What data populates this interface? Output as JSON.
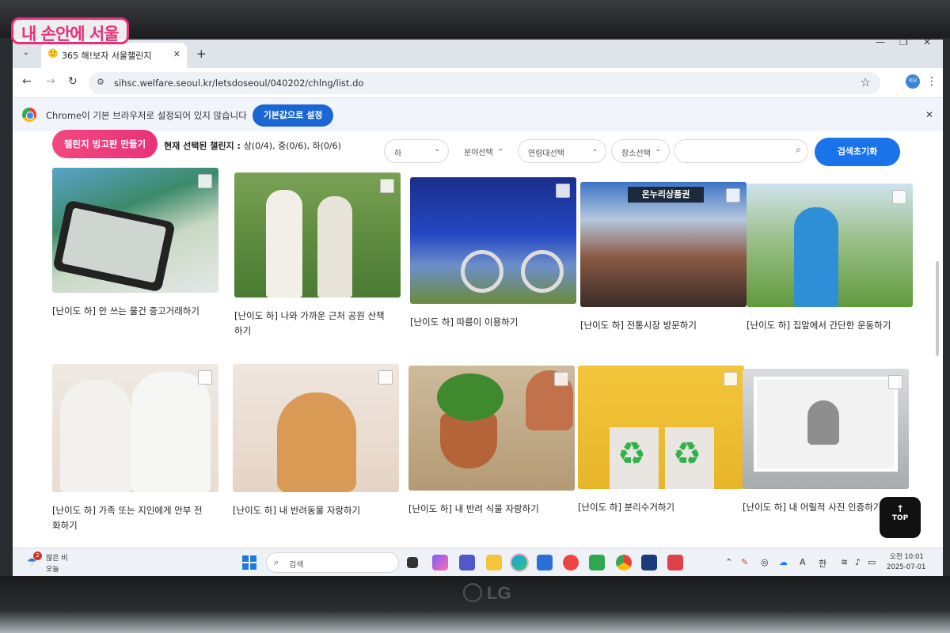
{
  "watermark": {
    "logo_text": "내 손안에 서울"
  },
  "monitor": {
    "brand": "LG"
  },
  "browser": {
    "tab_title": "365 해!보자 서울챌린지",
    "url": "sihsc.welfare.seoul.kr/letsdoseoul/040202/chlng/list.do",
    "infobar_text": "Chrome이 기본 브라우저로 설정되어 있지 않습니다",
    "infobar_button": "기본값으로 설정",
    "profile_label": "외부"
  },
  "filters": {
    "bingo_button": "챌린지 빙고판 만들기",
    "status_prefix": "현재 선택된 챌린지 : ",
    "status_value": "상(0/4), 중(0/6), 하(0/6)",
    "difficulty": "하",
    "field": "분야선택",
    "age": "연령대선택",
    "place": "장소선택",
    "search_placeholder": "",
    "reset_button": "검색초기화"
  },
  "cards": [
    {
      "title": "[난이도 하] 안 쓰는 물건 중고거래하기",
      "thumb_icon": "phone-photo-icon"
    },
    {
      "title": "[난이도 하] 나와 가까운 근처 공원 산책하기",
      "thumb_icon": "couple-walk-icon"
    },
    {
      "title": "[난이도 하] 따릉이 이용하기",
      "thumb_icon": "bicycle-icon"
    },
    {
      "title": "[난이도 하] 전통시장 방문하기",
      "thumb_icon": "market-icon",
      "sign": "온누리상품권"
    },
    {
      "title": "[난이도 하] 집앞에서 간단한 운동하기",
      "thumb_icon": "exercise-icon"
    },
    {
      "title": "[난이도 하] 가족 또는 지인에게 안부 전화하기",
      "thumb_icon": "phone-call-icon"
    },
    {
      "title": "[난이도 하] 내 반려동물 자랑하기",
      "thumb_icon": "dog-icon"
    },
    {
      "title": "[난이도 하] 내 반려 식물 자랑하기",
      "thumb_icon": "plant-icon"
    },
    {
      "title": "[난이도 하] 분리수거하기",
      "thumb_icon": "recycle-icon",
      "symbol": "♻"
    },
    {
      "title": "[난이도 하] 내 어릴적 사진 인증하기",
      "thumb_icon": "baby-photo-icon"
    }
  ],
  "top_button": {
    "arrow": "↑",
    "label": "TOP"
  },
  "taskbar": {
    "weather_badge": "2",
    "weather_line1": "많은 비",
    "weather_line2": "오늘",
    "search_label": "검색",
    "ime_a": "A",
    "ime_lang": "한",
    "time": "오전 10:01",
    "date": "2025-07-01"
  }
}
